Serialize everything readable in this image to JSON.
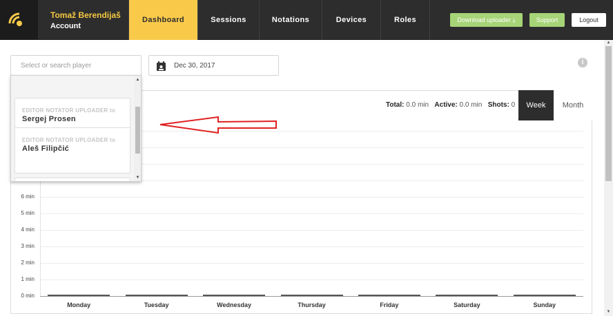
{
  "header": {
    "user_name": "Tomaž Berendijaš",
    "account_label": "Account",
    "tabs": [
      "Dashboard",
      "Sessions",
      "Notations",
      "Devices",
      "Roles"
    ],
    "active_tab": "Dashboard",
    "download_label": "Download uploader ⤓",
    "support_label": "Support",
    "logout_label": "Logout"
  },
  "filters": {
    "search_placeholder": "Select or search player",
    "date": "Dec 30, 2017"
  },
  "dropdown": {
    "items": [
      {
        "role": "EDITOR NOTATOR UPLOADER to",
        "name": "Sergej Prosen"
      },
      {
        "role": "EDITOR NOTATOR UPLOADER to",
        "name": "Aleš Filipčić"
      }
    ]
  },
  "stats": {
    "total_label": "Total:",
    "total_value": "0.0 min",
    "active_label": "Active:",
    "active_value": "0.0 min",
    "shots_label": "Shots:",
    "shots_value": "0"
  },
  "period": {
    "week": "Week",
    "month": "Month",
    "selected": "Week"
  },
  "chart_data": {
    "type": "bar",
    "categories": [
      "Monday",
      "Tuesday",
      "Wednesday",
      "Thursday",
      "Friday",
      "Saturday",
      "Sunday"
    ],
    "values": [
      0,
      0,
      0,
      0,
      0,
      0,
      0
    ],
    "y_ticks": [
      "0 min",
      "1 min",
      "2 min",
      "3 min",
      "4 min",
      "5 min",
      "6 min"
    ],
    "ylim": [
      0,
      10
    ],
    "grid": true
  },
  "colors": {
    "nav_bg": "#2d2d2d",
    "accent": "#f9ca4a",
    "green": "#a7d477",
    "annotation": "#e02020"
  }
}
